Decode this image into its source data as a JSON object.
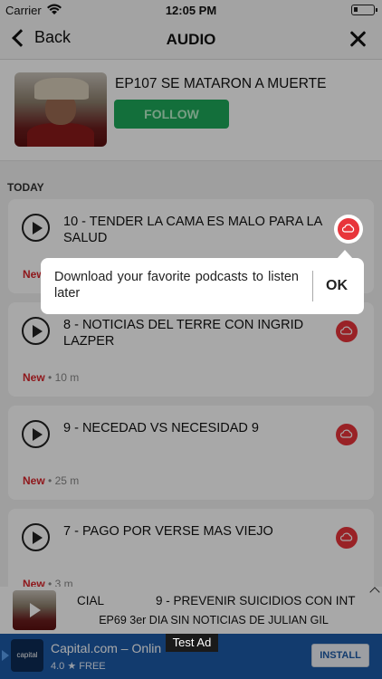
{
  "status_bar": {
    "carrier": "Carrier",
    "time": "12:05 PM"
  },
  "nav": {
    "back_label": "Back",
    "title": "AUDIO"
  },
  "podcast": {
    "title": "EP107 SE MATARON A MUERTE",
    "follow_label": "FOLLOW"
  },
  "list": {
    "section_label": "TODAY",
    "episodes": [
      {
        "title": "10 - TENDER LA CAMA ES MALO PARA LA SALUD",
        "new_label": "New",
        "duration": ""
      },
      {
        "title": "8 - NOTICIAS DEL TERRE CON INGRID LAZPER",
        "new_label": "New",
        "duration": "10 m"
      },
      {
        "title": "9 - NECEDAD VS NECESIDAD 9",
        "new_label": "New",
        "duration": "25 m"
      },
      {
        "title": "7 - PAGO POR VERSE MAS VIEJO",
        "new_label": "New",
        "duration": "3 m"
      }
    ]
  },
  "tooltip": {
    "message": "Download your favorite podcasts to listen later",
    "ok_label": "OK"
  },
  "mini_player": {
    "partial_label": "CIAL",
    "now_playing": "9 - PREVENIR SUICIDIOS CON INT",
    "subtitle": "EP69 3er DIA SIN NOTICIAS DE JULIAN GIL"
  },
  "ad": {
    "title": "Capital.com – Onlin",
    "logo_text": "capital",
    "rating": "4.0",
    "price": "FREE",
    "test_label": "Test Ad",
    "install_label": "INSTALL"
  }
}
